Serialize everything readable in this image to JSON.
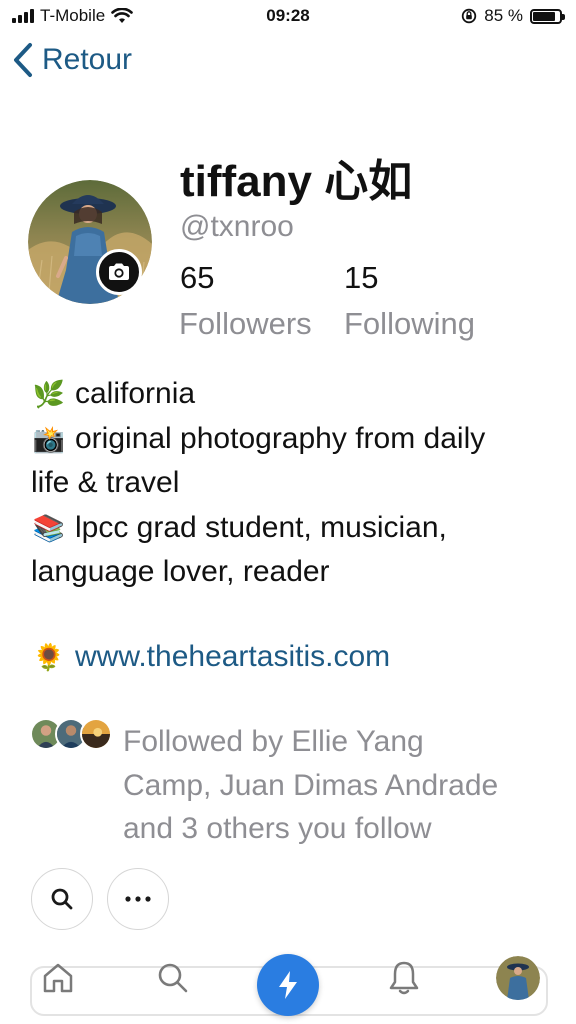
{
  "status_bar": {
    "carrier": "T-Mobile",
    "time": "09:28",
    "battery": "85 %",
    "battery_level": 0.85
  },
  "nav": {
    "back_label": "Retour"
  },
  "profile": {
    "name": "tiffany 心如",
    "handle": "@txnroo",
    "followers_count": "65",
    "followers_label": "Followers",
    "following_count": "15",
    "following_label": "Following"
  },
  "bio": {
    "lines": [
      {
        "emoji": "🌿",
        "text": "california"
      },
      {
        "emoji": "📸",
        "text": "original photography from daily"
      },
      {
        "emoji": "",
        "text": "life & travel"
      },
      {
        "emoji": "📚",
        "text": "lpcc grad student, musician,"
      },
      {
        "emoji": "",
        "text": "language lover, reader"
      }
    ],
    "link_emoji": "🌻",
    "link": "www.theheartasitis.com"
  },
  "followed_by": {
    "line1": "Followed by Ellie Yang",
    "line2": "Camp, Juan Dimas Andrade",
    "line3": "and 3 others you follow"
  },
  "actions": {
    "search_icon": "search-icon",
    "more_icon": "more-icon"
  },
  "tabbar": {
    "home_icon": "home-icon",
    "search_icon": "search-icon",
    "compose_icon": "lightning-icon",
    "notifications_icon": "bell-icon",
    "profile_icon": "avatar"
  },
  "colors": {
    "accent": "#1d5a85",
    "fab": "#2a7de1",
    "muted": "#8e8e93"
  }
}
